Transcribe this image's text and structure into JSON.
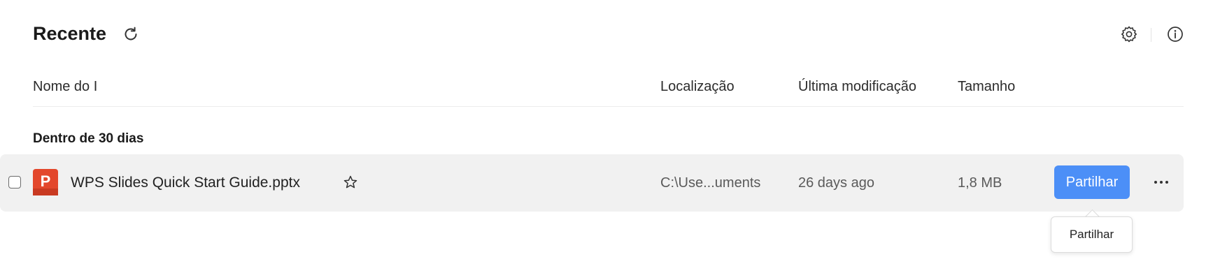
{
  "header": {
    "title": "Recente",
    "refresh_icon": "refresh-icon",
    "settings_icon": "gear-icon",
    "info_icon": "info-icon"
  },
  "columns": {
    "name": "Nome do I",
    "location": "Localização",
    "modified": "Última modificação",
    "size": "Tamanho"
  },
  "groups": [
    {
      "label": "Dentro de 30 dias",
      "files": [
        {
          "name": "WPS Slides Quick Start Guide.pptx",
          "icon": "presentation-file-icon",
          "location": "C:\\Use...uments",
          "modified": "26 days ago",
          "size": "1,8 MB",
          "share_label": "Partilhar",
          "starred": false
        }
      ]
    }
  ],
  "tooltip": {
    "text": "Partilhar"
  },
  "colors": {
    "accent": "#4c8ff7",
    "row_background": "#f1f1f1",
    "pptx_icon": "#e3472c"
  }
}
